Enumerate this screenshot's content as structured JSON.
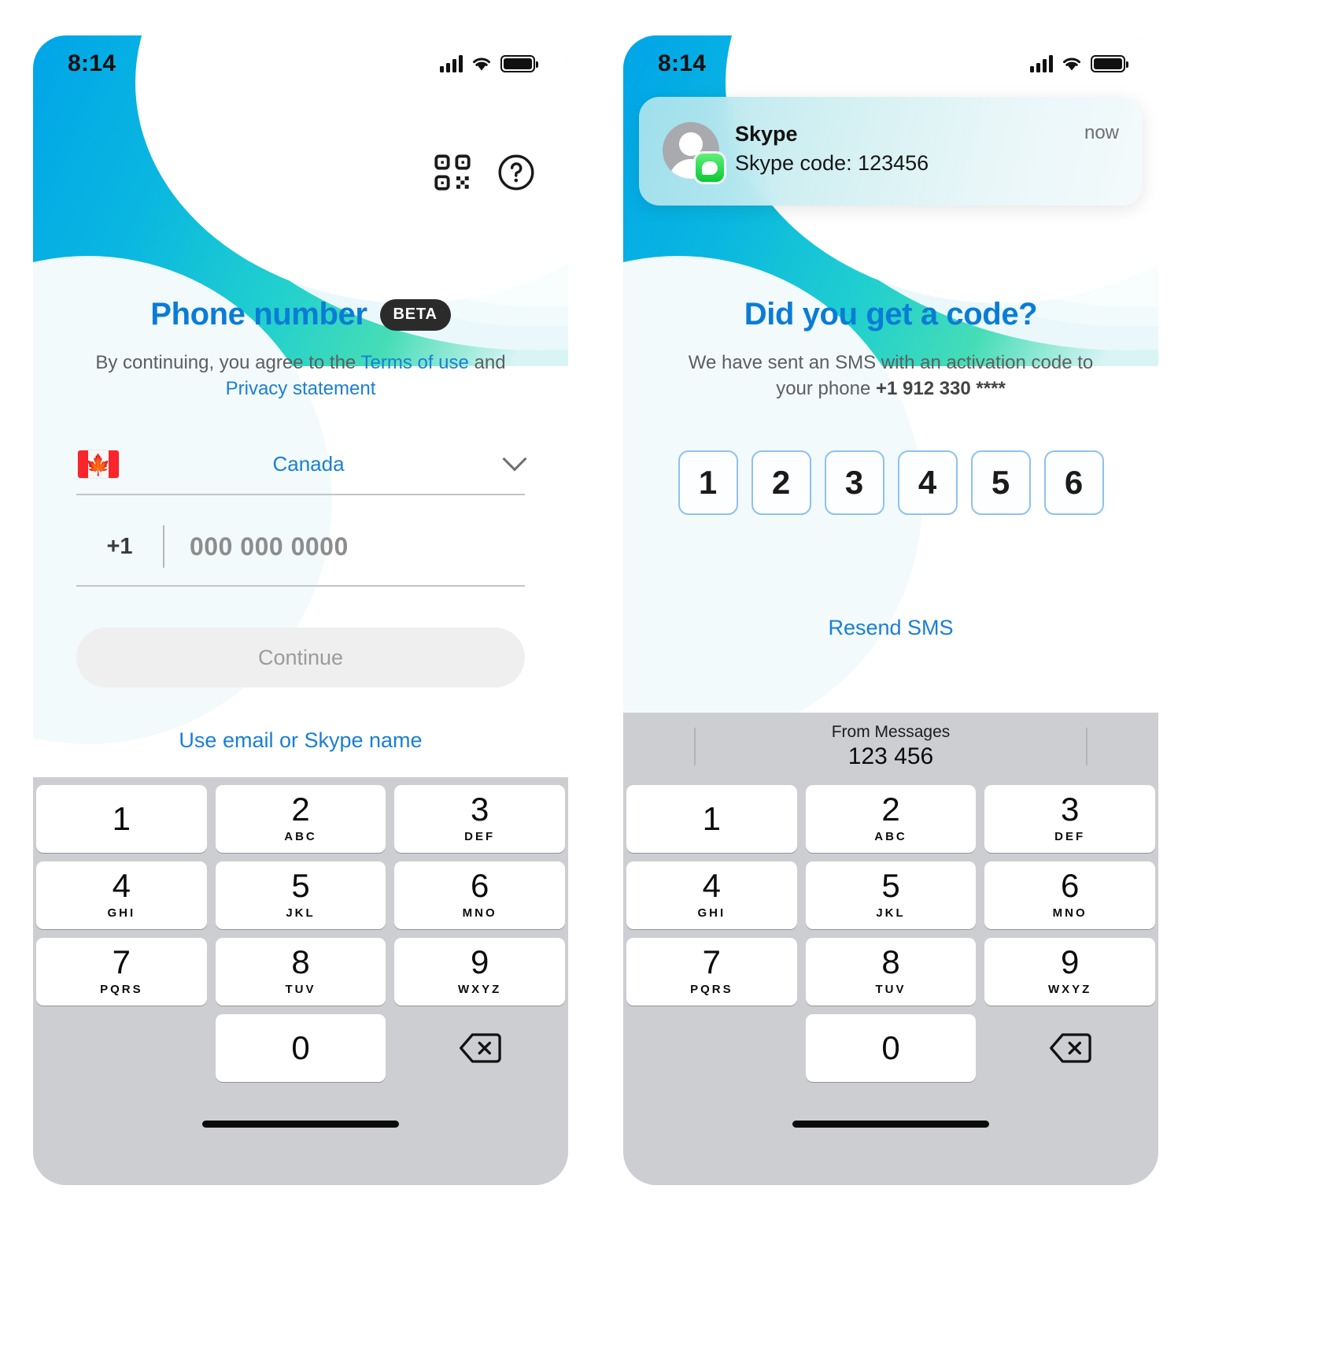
{
  "screens": [
    {
      "id": "phone-number",
      "status_bar": {
        "time": "8:14",
        "signal_icon": "cellular-bars-icon",
        "wifi_icon": "wifi-icon",
        "battery_icon": "battery-icon"
      },
      "header_actions": [
        {
          "name": "qr-code-icon",
          "label": "QR code"
        },
        {
          "name": "help-icon",
          "label": "Help"
        }
      ],
      "title": "Phone number",
      "badge": "BETA",
      "legal": {
        "prefix": "By continuing, you agree to the ",
        "terms_link": "Terms of use",
        "middle": " and ",
        "privacy_link": "Privacy statement"
      },
      "country": {
        "flag": "flag-canada-icon",
        "name": "Canada",
        "chevron": "chevron-down-icon"
      },
      "phone_field": {
        "country_code": "+1",
        "placeholder": "000 000 0000",
        "value": ""
      },
      "continue_label": "Continue",
      "alt_link": "Use email or Skype name",
      "keyboard": {
        "keys": [
          {
            "num": "1",
            "letters": ""
          },
          {
            "num": "2",
            "letters": "ABC"
          },
          {
            "num": "3",
            "letters": "DEF"
          },
          {
            "num": "4",
            "letters": "GHI"
          },
          {
            "num": "5",
            "letters": "JKL"
          },
          {
            "num": "6",
            "letters": "MNO"
          },
          {
            "num": "7",
            "letters": "PQRS"
          },
          {
            "num": "8",
            "letters": "TUV"
          },
          {
            "num": "9",
            "letters": "WXYZ"
          },
          {
            "num": "0",
            "letters": ""
          }
        ],
        "delete_icon": "backspace-icon"
      }
    },
    {
      "id": "verify-code",
      "status_bar": {
        "time": "8:14",
        "signal_icon": "cellular-bars-icon",
        "wifi_icon": "wifi-icon",
        "battery_icon": "battery-icon"
      },
      "notification": {
        "app": "Skype",
        "time": "now",
        "message": "Skype code: 123456",
        "avatar_icon": "person-avatar-icon",
        "badge_icon": "messages-app-icon"
      },
      "title": "Did you get a code?",
      "subtitle": {
        "line1": "We have sent an SMS with an activation code to",
        "line2_prefix": "your phone ",
        "phone": "+1 912 330 ****"
      },
      "otp_digits": [
        "1",
        "2",
        "3",
        "4",
        "5",
        "6"
      ],
      "resend_label": "Resend SMS",
      "autofill": {
        "label": "From Messages",
        "code": "123 456"
      },
      "keyboard": {
        "keys": [
          {
            "num": "1",
            "letters": ""
          },
          {
            "num": "2",
            "letters": "ABC"
          },
          {
            "num": "3",
            "letters": "DEF"
          },
          {
            "num": "4",
            "letters": "GHI"
          },
          {
            "num": "5",
            "letters": "JKL"
          },
          {
            "num": "6",
            "letters": "MNO"
          },
          {
            "num": "7",
            "letters": "PQRS"
          },
          {
            "num": "8",
            "letters": "TUV"
          },
          {
            "num": "9",
            "letters": "WXYZ"
          },
          {
            "num": "0",
            "letters": ""
          }
        ],
        "delete_icon": "backspace-icon"
      }
    }
  ],
  "colors": {
    "accent_blue": "#1a7fd4",
    "title_blue": "#0a7cd6",
    "gradient_start": "#00a5e8",
    "gradient_end": "#45ddb6",
    "keyboard_bg": "#cdced2",
    "otp_border": "#8dc2ef",
    "badge_dark": "#2b2b2b",
    "messages_green": "#0bc832"
  }
}
